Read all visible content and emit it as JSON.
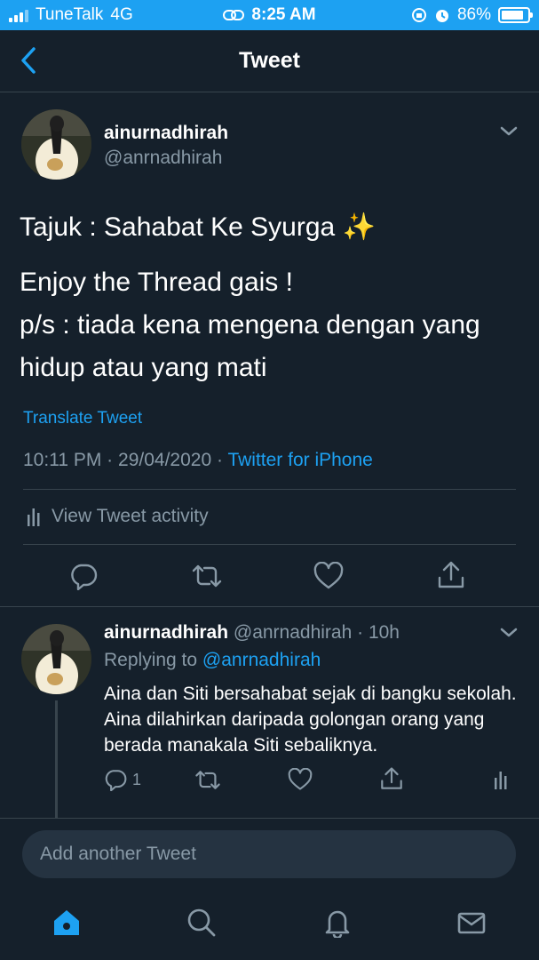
{
  "status_bar": {
    "carrier": "TuneTalk",
    "network": "4G",
    "time": "8:25 AM",
    "battery_text": "86%",
    "battery_level": 0.86
  },
  "nav": {
    "title": "Tweet"
  },
  "main_tweet": {
    "name": "ainurnadhirah",
    "handle": "@anrnadhirah",
    "text_lines": [
      "Tajuk : Sahabat Ke Syurga ✨",
      "Enjoy the Thread gais !",
      "p/s : tiada kena mengena dengan yang",
      "hidup atau yang mati"
    ],
    "translate": "Translate Tweet",
    "time": "10:11 PM",
    "date": "29/04/2020",
    "separator": "·",
    "source": "Twitter for iPhone",
    "activity": "View Tweet activity"
  },
  "reply": {
    "name": "ainurnadhirah",
    "handle": "@anrnadhirah",
    "age": "· 10h",
    "replying_label": "Replying to",
    "replying_to": "@anrnadhirah",
    "body": "Aina dan Siti bersahabat sejak di bangku sekolah. Aina dilahirkan daripada golongan orang yang berada manakala Siti sebaliknya.",
    "reply_count": "1"
  },
  "compose": {
    "placeholder": "Add another Tweet"
  },
  "colors": {
    "background": "#15202b",
    "accent": "#1da1f2",
    "muted": "#8899a6",
    "divider": "#38444d"
  },
  "icons": [
    "back-icon",
    "chevron-down-icon",
    "reply-icon",
    "retweet-icon",
    "like-icon",
    "share-icon",
    "activity-icon",
    "home-icon",
    "search-icon",
    "notifications-icon",
    "messages-icon"
  ]
}
